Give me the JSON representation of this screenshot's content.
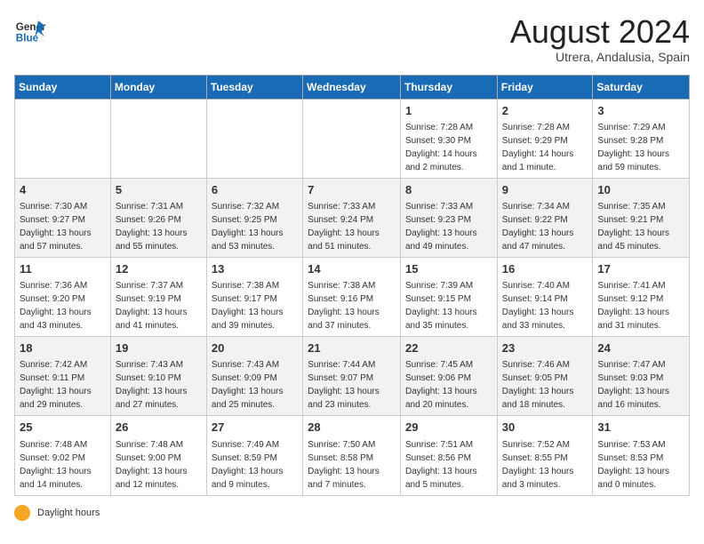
{
  "logo": {
    "line1": "General",
    "line2": "Blue"
  },
  "calendar": {
    "title": "August 2024",
    "subtitle": "Utrera, Andalusia, Spain"
  },
  "weekdays": [
    "Sunday",
    "Monday",
    "Tuesday",
    "Wednesday",
    "Thursday",
    "Friday",
    "Saturday"
  ],
  "weeks": [
    [
      {
        "day": "",
        "info": ""
      },
      {
        "day": "",
        "info": ""
      },
      {
        "day": "",
        "info": ""
      },
      {
        "day": "",
        "info": ""
      },
      {
        "day": "1",
        "info": "Sunrise: 7:28 AM\nSunset: 9:30 PM\nDaylight: 14 hours and 2 minutes."
      },
      {
        "day": "2",
        "info": "Sunrise: 7:28 AM\nSunset: 9:29 PM\nDaylight: 14 hours and 1 minute."
      },
      {
        "day": "3",
        "info": "Sunrise: 7:29 AM\nSunset: 9:28 PM\nDaylight: 13 hours and 59 minutes."
      }
    ],
    [
      {
        "day": "4",
        "info": "Sunrise: 7:30 AM\nSunset: 9:27 PM\nDaylight: 13 hours and 57 minutes."
      },
      {
        "day": "5",
        "info": "Sunrise: 7:31 AM\nSunset: 9:26 PM\nDaylight: 13 hours and 55 minutes."
      },
      {
        "day": "6",
        "info": "Sunrise: 7:32 AM\nSunset: 9:25 PM\nDaylight: 13 hours and 53 minutes."
      },
      {
        "day": "7",
        "info": "Sunrise: 7:33 AM\nSunset: 9:24 PM\nDaylight: 13 hours and 51 minutes."
      },
      {
        "day": "8",
        "info": "Sunrise: 7:33 AM\nSunset: 9:23 PM\nDaylight: 13 hours and 49 minutes."
      },
      {
        "day": "9",
        "info": "Sunrise: 7:34 AM\nSunset: 9:22 PM\nDaylight: 13 hours and 47 minutes."
      },
      {
        "day": "10",
        "info": "Sunrise: 7:35 AM\nSunset: 9:21 PM\nDaylight: 13 hours and 45 minutes."
      }
    ],
    [
      {
        "day": "11",
        "info": "Sunrise: 7:36 AM\nSunset: 9:20 PM\nDaylight: 13 hours and 43 minutes."
      },
      {
        "day": "12",
        "info": "Sunrise: 7:37 AM\nSunset: 9:19 PM\nDaylight: 13 hours and 41 minutes."
      },
      {
        "day": "13",
        "info": "Sunrise: 7:38 AM\nSunset: 9:17 PM\nDaylight: 13 hours and 39 minutes."
      },
      {
        "day": "14",
        "info": "Sunrise: 7:38 AM\nSunset: 9:16 PM\nDaylight: 13 hours and 37 minutes."
      },
      {
        "day": "15",
        "info": "Sunrise: 7:39 AM\nSunset: 9:15 PM\nDaylight: 13 hours and 35 minutes."
      },
      {
        "day": "16",
        "info": "Sunrise: 7:40 AM\nSunset: 9:14 PM\nDaylight: 13 hours and 33 minutes."
      },
      {
        "day": "17",
        "info": "Sunrise: 7:41 AM\nSunset: 9:12 PM\nDaylight: 13 hours and 31 minutes."
      }
    ],
    [
      {
        "day": "18",
        "info": "Sunrise: 7:42 AM\nSunset: 9:11 PM\nDaylight: 13 hours and 29 minutes."
      },
      {
        "day": "19",
        "info": "Sunrise: 7:43 AM\nSunset: 9:10 PM\nDaylight: 13 hours and 27 minutes."
      },
      {
        "day": "20",
        "info": "Sunrise: 7:43 AM\nSunset: 9:09 PM\nDaylight: 13 hours and 25 minutes."
      },
      {
        "day": "21",
        "info": "Sunrise: 7:44 AM\nSunset: 9:07 PM\nDaylight: 13 hours and 23 minutes."
      },
      {
        "day": "22",
        "info": "Sunrise: 7:45 AM\nSunset: 9:06 PM\nDaylight: 13 hours and 20 minutes."
      },
      {
        "day": "23",
        "info": "Sunrise: 7:46 AM\nSunset: 9:05 PM\nDaylight: 13 hours and 18 minutes."
      },
      {
        "day": "24",
        "info": "Sunrise: 7:47 AM\nSunset: 9:03 PM\nDaylight: 13 hours and 16 minutes."
      }
    ],
    [
      {
        "day": "25",
        "info": "Sunrise: 7:48 AM\nSunset: 9:02 PM\nDaylight: 13 hours and 14 minutes."
      },
      {
        "day": "26",
        "info": "Sunrise: 7:48 AM\nSunset: 9:00 PM\nDaylight: 13 hours and 12 minutes."
      },
      {
        "day": "27",
        "info": "Sunrise: 7:49 AM\nSunset: 8:59 PM\nDaylight: 13 hours and 9 minutes."
      },
      {
        "day": "28",
        "info": "Sunrise: 7:50 AM\nSunset: 8:58 PM\nDaylight: 13 hours and 7 minutes."
      },
      {
        "day": "29",
        "info": "Sunrise: 7:51 AM\nSunset: 8:56 PM\nDaylight: 13 hours and 5 minutes."
      },
      {
        "day": "30",
        "info": "Sunrise: 7:52 AM\nSunset: 8:55 PM\nDaylight: 13 hours and 3 minutes."
      },
      {
        "day": "31",
        "info": "Sunrise: 7:53 AM\nSunset: 8:53 PM\nDaylight: 13 hours and 0 minutes."
      }
    ]
  ],
  "footer": {
    "sun_label": "Daylight hours"
  }
}
